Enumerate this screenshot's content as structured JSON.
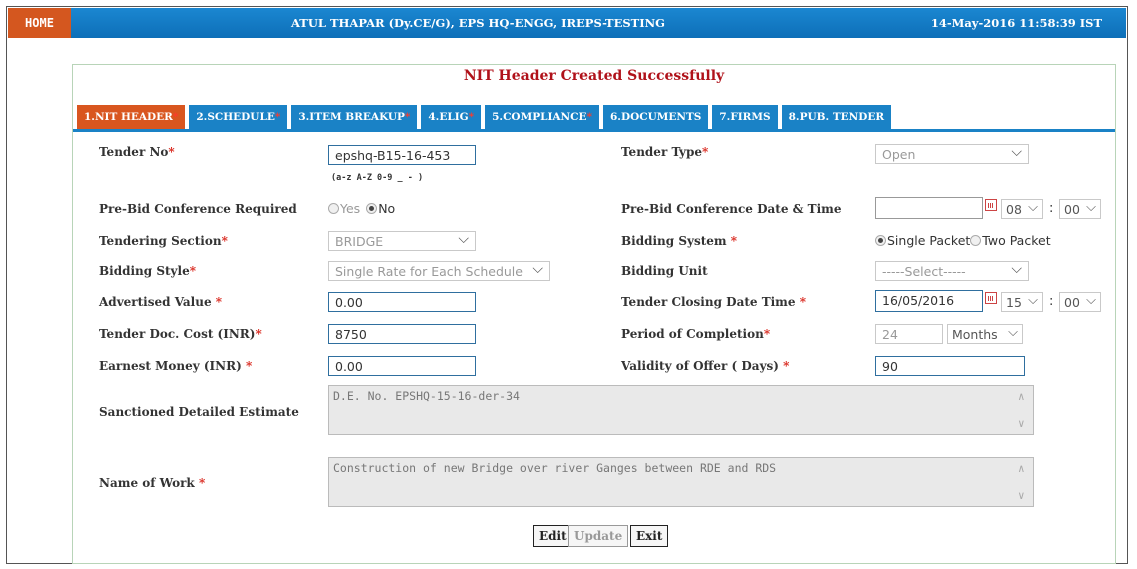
{
  "header": {
    "home_label": "HOME",
    "user_info": "ATUL THAPAR (Dy.CE/G), EPS HQ-ENGG, IREPS-TESTING",
    "datetime": "14-May-2016 11:58:39 IST"
  },
  "message": "NIT Header Created Successfully",
  "tabs": [
    {
      "label": "1.NIT HEADER",
      "required": true,
      "active": true
    },
    {
      "label": "2.SCHEDULE",
      "required": true,
      "active": false
    },
    {
      "label": "3.ITEM BREAKUP",
      "required": true,
      "active": false
    },
    {
      "label": "4.ELIG",
      "required": true,
      "active": false
    },
    {
      "label": "5.COMPLIANCE",
      "required": true,
      "active": false
    },
    {
      "label": "6.DOCUMENTS",
      "required": false,
      "active": false
    },
    {
      "label": "7.FIRMS",
      "required": false,
      "active": false
    },
    {
      "label": "8.PUB. TENDER",
      "required": false,
      "active": false
    }
  ],
  "form": {
    "tender_no": {
      "label": "Tender No",
      "value": "epshq-B15-16-453",
      "hint": "(a-z A-Z 0-9 _ - )"
    },
    "tender_type": {
      "label": "Tender Type",
      "value": "Open"
    },
    "prebid_required": {
      "label": "Pre-Bid Conference Required",
      "options": [
        "Yes",
        "No"
      ],
      "selected": "No"
    },
    "prebid_datetime": {
      "label": "Pre-Bid Conference Date & Time",
      "date": "",
      "hour": "08",
      "minute": "00"
    },
    "tendering_section": {
      "label": "Tendering Section",
      "value": "BRIDGE"
    },
    "bidding_system": {
      "label": "Bidding System",
      "options": [
        "Single Packet",
        "Two Packet"
      ],
      "selected": "Single Packet"
    },
    "bidding_style": {
      "label": "Bidding Style",
      "value": "Single Rate for Each Schedule"
    },
    "bidding_unit": {
      "label": "Bidding Unit",
      "value": "-----Select-----"
    },
    "advertised_value": {
      "label": "Advertised Value",
      "value": "0.00"
    },
    "closing_datetime": {
      "label": "Tender Closing Date Time",
      "date": "16/05/2016",
      "hour": "15",
      "minute": "00"
    },
    "doc_cost": {
      "label": "Tender Doc. Cost (INR)",
      "value": "8750"
    },
    "period_completion": {
      "label": "Period of Completion",
      "value": "24",
      "unit": "Months"
    },
    "earnest_money": {
      "label": "Earnest Money (INR)",
      "value": "0.00"
    },
    "validity": {
      "label": "Validity of Offer ( Days)",
      "value": "90"
    },
    "sanctioned_estimate": {
      "label": "Sanctioned Detailed Estimate",
      "value": "D.E. No. EPSHQ-15-16-der-34"
    },
    "name_of_work": {
      "label": "Name of Work",
      "value": "Construction of new Bridge over river Ganges between RDE and RDS"
    }
  },
  "buttons": {
    "edit": "Edit",
    "update": "Update",
    "exit": "Exit"
  },
  "req_mark": "*",
  "colon": ":"
}
